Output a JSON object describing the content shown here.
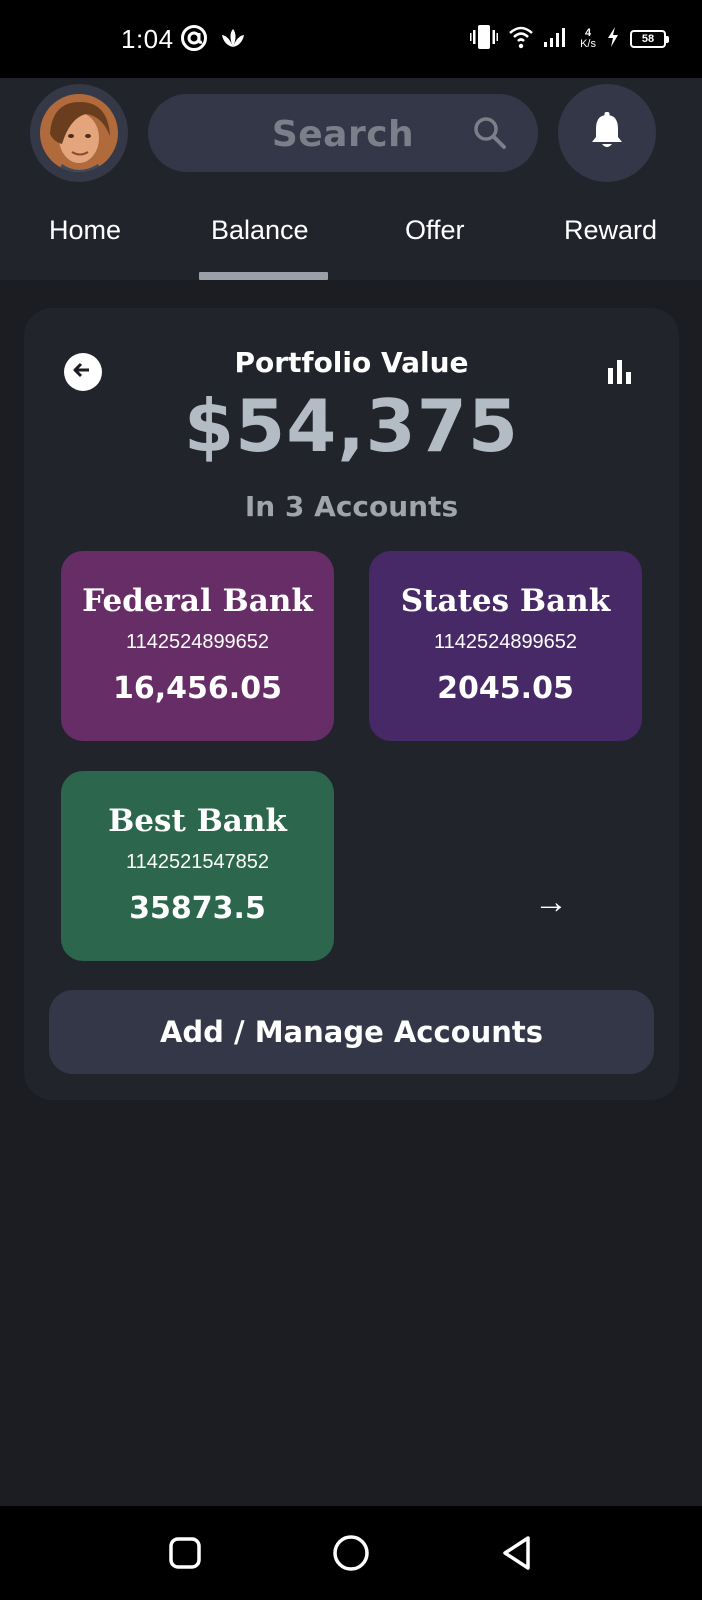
{
  "status_bar": {
    "time": "1:04",
    "net_speed_value": "4",
    "net_speed_unit": "K/s",
    "battery": "58",
    "icons": [
      "at-sign-icon",
      "lotus-icon",
      "vibrate-icon",
      "wifi-icon",
      "signal-icon",
      "charging-icon",
      "battery-icon"
    ]
  },
  "header": {
    "avatar": "avatar",
    "search": {
      "placeholder": "Search",
      "icon": "search-icon"
    },
    "notification_icon": "bell-icon"
  },
  "tabs": [
    {
      "label": "Home",
      "active": false
    },
    {
      "label": "Balance",
      "active": true
    },
    {
      "label": "Offer",
      "active": false
    },
    {
      "label": "Reward",
      "active": false
    }
  ],
  "portfolio": {
    "label": "Portfolio Value",
    "value": "$54,375",
    "subtitle": "In 3 Accounts",
    "back_icon": "arrow-left-icon",
    "chart_icon": "bar-chart-icon"
  },
  "accounts": [
    {
      "name": "Federal Bank",
      "number": "1142524899652",
      "balance": "16,456.05",
      "color": "#672d66"
    },
    {
      "name": "States Bank",
      "number": "1142524899652",
      "balance": "2045.05",
      "color": "#462966"
    },
    {
      "name": "Best Bank",
      "number": "1142521547852",
      "balance": "35873.5",
      "color": "#2c664d"
    }
  ],
  "more_arrow": "→",
  "manage_button": {
    "label": "Add / Manage Accounts"
  },
  "colors": {
    "background": "#1c1d22",
    "surface": "#22242c",
    "control": "#343747",
    "accent_text": "#b3bcc5"
  },
  "nav_bar": {
    "icons": [
      "recent-apps-icon",
      "home-circle-icon",
      "back-triangle-icon"
    ]
  }
}
